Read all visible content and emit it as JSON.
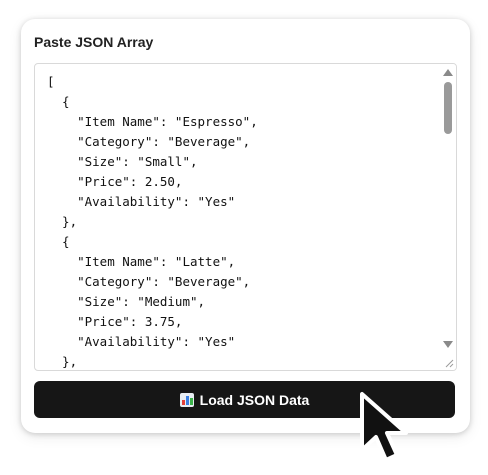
{
  "panel": {
    "label": "Paste JSON Array",
    "json_text": "[\n  {\n    \"Item Name\": \"Espresso\",\n    \"Category\": \"Beverage\",\n    \"Size\": \"Small\",\n    \"Price\": 2.50,\n    \"Availability\": \"Yes\"\n  },\n  {\n    \"Item Name\": \"Latte\",\n    \"Category\": \"Beverage\",\n    \"Size\": \"Medium\",\n    \"Price\": 3.75,\n    \"Availability\": \"Yes\"\n  },"
  },
  "button": {
    "label": "Load JSON Data",
    "icon": "bar-chart-icon"
  },
  "colors": {
    "button_bg": "#161616",
    "button_text": "#ffffff"
  }
}
